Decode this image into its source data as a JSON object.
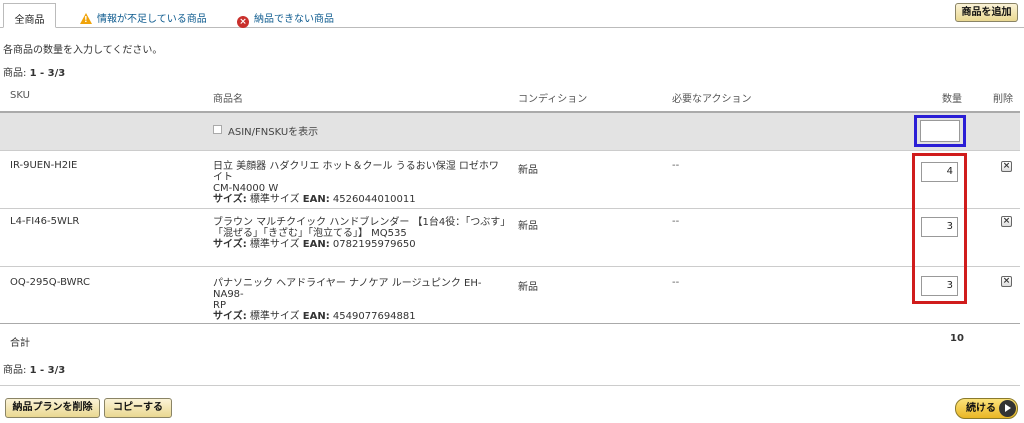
{
  "tabs": [
    {
      "label": "全商品",
      "active": true
    },
    {
      "label": "情報が不足している商品",
      "icon": "warning-icon"
    },
    {
      "label": "納品できない商品",
      "icon": "error-icon"
    }
  ],
  "add_product_button": "商品を追加",
  "instruction": "各商品の数量を入力してください。",
  "count_top": {
    "label": "商品:",
    "value": "1 - 3/3"
  },
  "count_bottom": {
    "label": "商品:",
    "value": "1 - 3/3"
  },
  "columns": {
    "sku": "SKU",
    "name": "商品名",
    "condition": "コンディション",
    "action": "必要なアクション",
    "quantity": "数量",
    "delete": "削除"
  },
  "show_asin_label": "ASIN/FNSKUを表示",
  "products": [
    {
      "sku": "IR-9UEN-H2IE",
      "name_lines": [
        "日立 美顔器 ハダクリエ ホット＆クール うるおい保湿 ロゼホワイト",
        "CM-N4000 W"
      ],
      "size_label": "サイズ:",
      "size_value": "標準サイズ",
      "ean_label": "EAN:",
      "ean_value": "4526044010011",
      "condition": "新品",
      "action": "--",
      "quantity": "4"
    },
    {
      "sku": "L4-FI46-5WLR",
      "name_lines": [
        "ブラウン マルチクイック ハンドブレンダー 【1台4役：「つぶす」",
        "「混ぜる」「きざむ」「泡立てる」】 MQ535"
      ],
      "size_label": "サイズ:",
      "size_value": "標準サイズ",
      "ean_label": "EAN:",
      "ean_value": "0782195979650",
      "condition": "新品",
      "action": "--",
      "quantity": "3"
    },
    {
      "sku": "OQ-295Q-BWRC",
      "name_lines": [
        "パナソニック ヘアドライヤー ナノケア ルージュピンク EH-NA98-",
        "RP"
      ],
      "size_label": "サイズ:",
      "size_value": "標準サイズ",
      "ean_label": "EAN:",
      "ean_value": "4549077694881",
      "condition": "新品",
      "action": "--",
      "quantity": "3"
    }
  ],
  "total_label": "合計",
  "total_value": "10",
  "delete_plan_button": "納品プランを削除",
  "copy_button": "コピーする",
  "continue_button": "続ける",
  "colors": {
    "blue_highlight": "#2b1fd6",
    "red_highlight": "#d01c1c",
    "button_gradient_top": "#fbf3d7",
    "continue_gradient": "#e9b625"
  }
}
